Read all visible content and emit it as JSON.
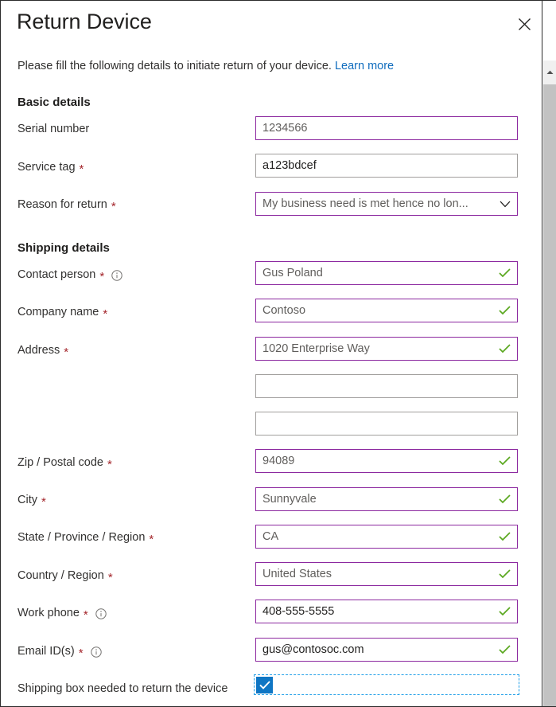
{
  "dialog": {
    "title": "Return Device",
    "close_label": "Close",
    "intro_text": "Please fill the following details to initiate return of your device.",
    "intro_link": "Learn more"
  },
  "sections": {
    "basic": {
      "heading": "Basic details",
      "fields": {
        "serial_number": {
          "label": "Serial number",
          "value": "1234566",
          "required": false
        },
        "service_tag": {
          "label": "Service tag",
          "value": "a123bdcef",
          "required": true
        },
        "reason_for_return": {
          "label": "Reason for return",
          "value": "My business need is met hence no lon...",
          "required": true
        }
      }
    },
    "shipping": {
      "heading": "Shipping details",
      "fields": {
        "contact_person": {
          "label": "Contact person",
          "value": "Gus Poland",
          "required": true
        },
        "company_name": {
          "label": "Company name",
          "value": "Contoso",
          "required": true
        },
        "address_line1": {
          "label": "Address",
          "value": "1020 Enterprise Way",
          "required": true
        },
        "address_line2": {
          "label": "",
          "value": "",
          "required": false
        },
        "address_line3": {
          "label": "",
          "value": "",
          "required": false
        },
        "zip_postal_code": {
          "label": "Zip / Postal code",
          "value": "94089",
          "required": true
        },
        "city": {
          "label": "City",
          "value": "Sunnyvale",
          "required": true
        },
        "state_province_region": {
          "label": "State / Province / Region",
          "value": "CA",
          "required": true
        },
        "country_region": {
          "label": "Country / Region",
          "value": "United States",
          "required": true
        },
        "work_phone": {
          "label": "Work phone",
          "value": "408-555-5555",
          "required": true
        },
        "email_ids": {
          "label": "Email ID(s)",
          "value": "gus@contosoc.com",
          "required": true
        }
      },
      "shipping_box_checkbox": {
        "label": "Shipping box needed to return the device",
        "checked": true
      }
    }
  },
  "symbols": {
    "required_marker": "*"
  },
  "colors": {
    "accent_border": "#8c29a0",
    "default_border": "#a19f9d",
    "valid_check": "#5ba820",
    "link": "#0f6cbd",
    "required_asterisk": "#a4262c",
    "checkbox_fill": "#0f76c4",
    "focus_outline": "#23a0e8",
    "scrollbar_thumb": "#c2c2c2"
  }
}
